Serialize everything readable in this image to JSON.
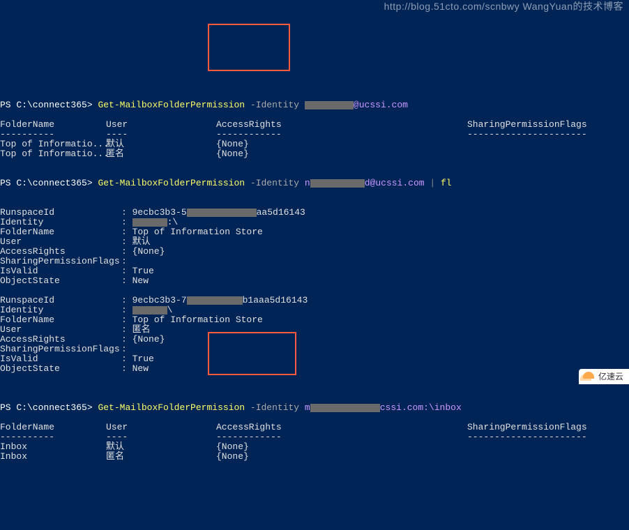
{
  "watermark": "http://blog.51cto.com/scnbwy WangYuan的技术博客",
  "logo": "亿速云",
  "prompt": "PS C:\\connect365>",
  "cmds": {
    "cmd1": {
      "name": "Get-MailboxFolderPermission",
      "param": "-Identity",
      "redactedSuffix": "@ucssi.com"
    },
    "cmd2": {
      "name": "Get-MailboxFolderPermission",
      "param": "-Identity",
      "redactedPrefix": "n",
      "redactedSuffix": "d@ucssi.com",
      "pipe": "|",
      "format": "fl"
    },
    "cmd3": {
      "name": "Get-MailboxFolderPermission",
      "param": "-Identity",
      "redactedPrefix": "m",
      "redactedSuffix": "cssi.com:\\inbox"
    }
  },
  "headers": {
    "FolderName": "FolderName",
    "User": "User",
    "AccessRights": "AccessRights",
    "SharingPermissionFlags": "SharingPermissionFlags",
    "sepFN": "----------",
    "sepUS": "----",
    "sepAR": "------------",
    "sepSP": "----------------------"
  },
  "table1": [
    {
      "fn": "Top of Informatio...",
      "us": "默认",
      "ar": "{None}"
    },
    {
      "fn": "Top of Informatio...",
      "us": "匿名",
      "ar": "{None}"
    }
  ],
  "fl1": {
    "RunspaceId": "9ecbc3b3-5",
    "RunspaceIdTail": "aa5d16143",
    "Identity": ":\\",
    "FolderName": "Top of Information Store",
    "User": "默认",
    "AccessRights": "{None}",
    "SharingPermissionFlags": "",
    "IsValid": "True",
    "ObjectState": "New"
  },
  "fl2": {
    "RunspaceId": "9ecbc3b3-7",
    "RunspaceIdTail": "b1aaa5d16143",
    "Identity": "\\",
    "FolderName": "Top of Information Store",
    "User": "匿名",
    "AccessRights": "{None}",
    "SharingPermissionFlags": "",
    "IsValid": "True",
    "ObjectState": "New"
  },
  "flKeys": {
    "RunspaceId": "RunspaceId",
    "Identity": "Identity",
    "FolderName": "FolderName",
    "User": "User",
    "AccessRights": "AccessRights",
    "SharingPermissionFlags": "SharingPermissionFlags",
    "IsValid": "IsValid",
    "ObjectState": "ObjectState"
  },
  "table3": [
    {
      "fn": "Inbox",
      "us": "默认",
      "ar": "{None}"
    },
    {
      "fn": "Inbox",
      "us": "匿名",
      "ar": "{None}"
    }
  ]
}
